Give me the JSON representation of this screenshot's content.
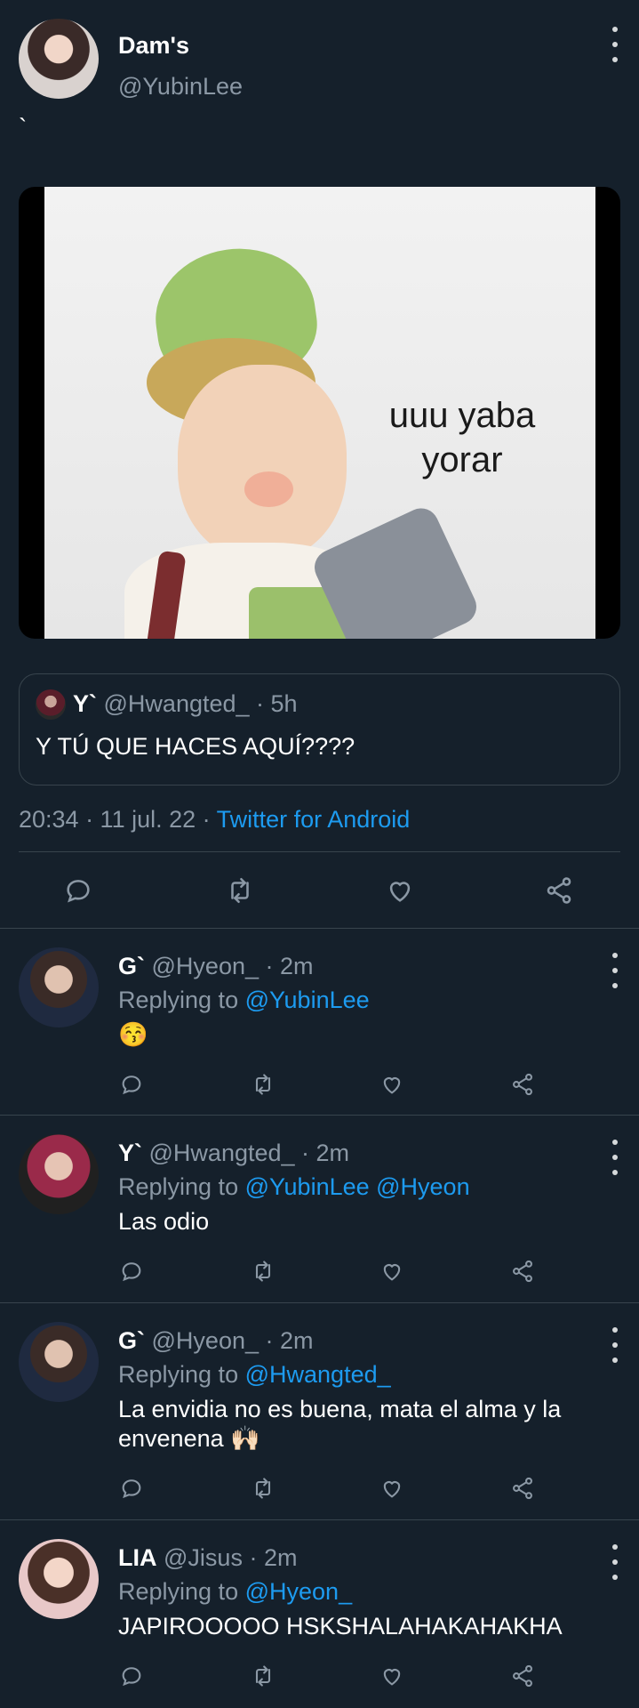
{
  "tweet": {
    "name": "Dam's",
    "handle": "@YubinLee",
    "text": "`",
    "meme_text": [
      "uuu yaba",
      "yorar"
    ],
    "quote": {
      "name": "Y`",
      "handle": "@Hwangted_",
      "time": "· 5h",
      "text": "Y TÚ QUE HACES AQUÍ????"
    },
    "timestamp": "20:34 · 11 jul. 22 ·",
    "source": "Twitter for Android"
  },
  "icons": {
    "reply": "reply-icon",
    "retweet": "retweet-icon",
    "like": "heart-icon",
    "share": "share-icon",
    "more": "more-vertical-icon"
  },
  "replies": [
    {
      "name": "G`",
      "handle": "@Hyeon_",
      "time": "· 2m",
      "replying_label": "Replying to",
      "replying_to": "@YubinLee",
      "text": "😚"
    },
    {
      "name": "Y`",
      "handle": "@Hwangted_",
      "time": "· 2m",
      "replying_label": "Replying to",
      "replying_to": "@YubinLee @Hyeon",
      "text": "Las odio"
    },
    {
      "name": "G`",
      "handle": "@Hyeon_",
      "time": "· 2m",
      "replying_label": "Replying to",
      "replying_to": "@Hwangted_",
      "text": "La envidia no es buena, mata el alma y la envenena 🙌🏻"
    },
    {
      "name": "LIA",
      "handle": "@Jisus",
      "time": "· 2m",
      "replying_label": "Replying to",
      "replying_to": "@Hyeon_",
      "text": "JAPIROOOOO HSKSHALAHAKAHAKHA"
    }
  ],
  "colors": {
    "background": "#15202b",
    "link": "#1d9bf0",
    "muted": "#8b98a5",
    "divider": "#38444d"
  }
}
